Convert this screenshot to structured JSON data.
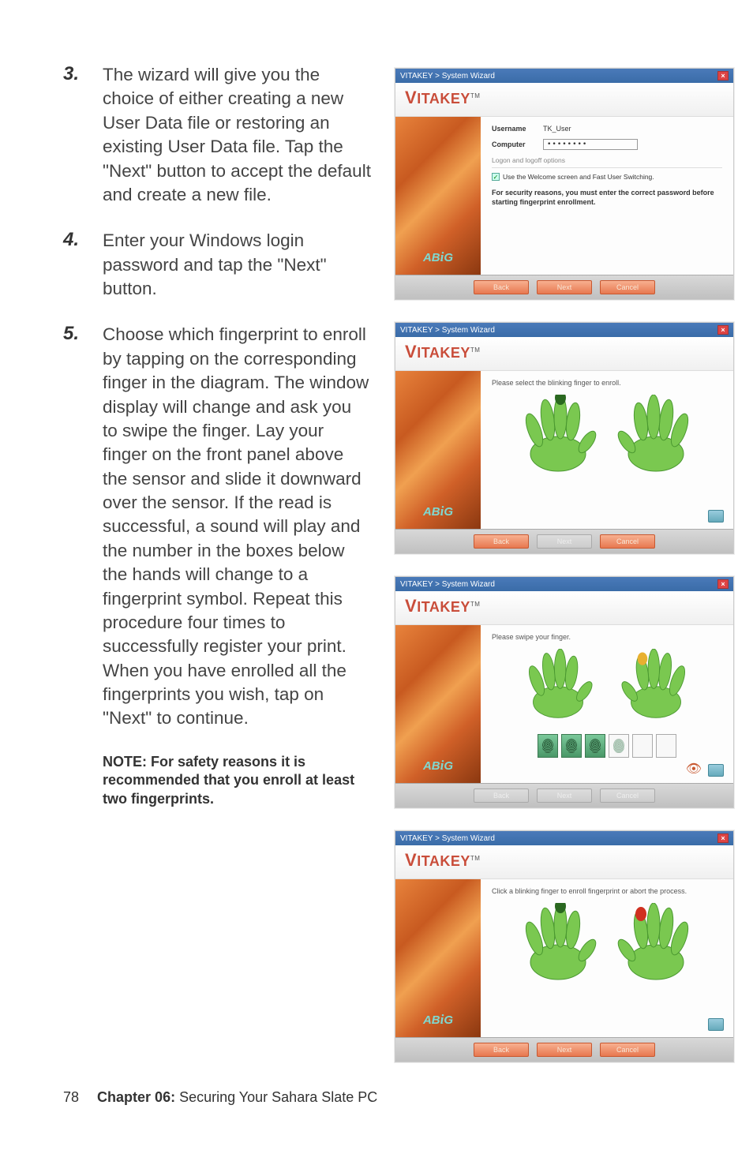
{
  "steps": [
    {
      "num": "3.",
      "text": "The wizard will give you the choice of either creating a new User Data file or restoring an existing User Data file. Tap the \"Next\" button to accept the default and create a new file."
    },
    {
      "num": "4.",
      "text": "Enter your Windows login password and tap the \"Next\" button."
    },
    {
      "num": "5.",
      "text": "Choose which fingerprint to enroll by tapping on the corresponding finger in the diagram. The window display will change and ask you to swipe the finger. Lay your finger on the front panel above the sensor and slide it downward over the sensor. If the read is successful, a sound will play and the number in the boxes below the hands will change to a fingerprint symbol. Repeat this procedure four times to successfully register your print. When you have enrolled all the fingerprints you wish, tap on \"Next\" to continue."
    }
  ],
  "note": "NOTE: For safety reasons it is recommended that you enroll at least two fingerprints.",
  "footer": {
    "page": "78",
    "chapter": "Chapter 06:",
    "title": " Securing Your Sahara Slate PC"
  },
  "wizard": {
    "titlebar": "VITAKEY > System Wizard",
    "brand": "VITAKEY",
    "brand_tm": "TM",
    "side_brand": "AB i G",
    "buttons": {
      "back": "Back",
      "next": "Next",
      "cancel": "Cancel"
    }
  },
  "screen1": {
    "username_label": "Username",
    "username_value": "TK_User",
    "computer_label": "Computer",
    "computer_value": "••••••••",
    "options_label": "Logon and logoff options",
    "checkbox_label": "Use the Welcome screen and Fast User Switching.",
    "security_msg": "For security reasons, you must enter the correct password before starting fingerprint enrollment."
  },
  "screen2": {
    "instruction": "Please select the blinking finger to enroll."
  },
  "screen3": {
    "instruction": "Please swipe your finger.",
    "filled_boxes": 3,
    "partial_boxes": 1,
    "empty_boxes": 2
  },
  "screen4": {
    "instruction": "Click a blinking finger to enroll fingerprint or abort the process."
  }
}
